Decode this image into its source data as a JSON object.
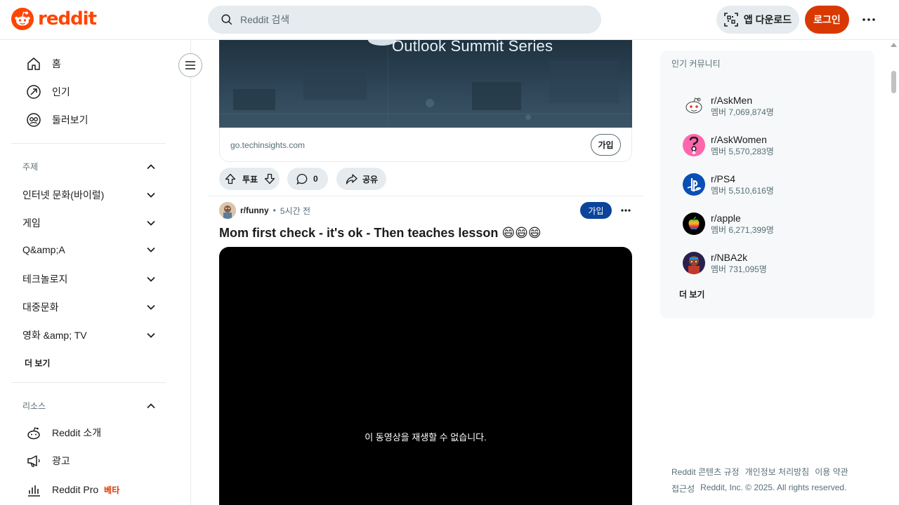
{
  "header": {
    "logo_text": "reddit",
    "search_placeholder": "Reddit 검색",
    "app_download_label": "앱 다운로드",
    "login_label": "로그인"
  },
  "sidebar": {
    "nav": [
      {
        "label": "홈",
        "icon": "home-icon"
      },
      {
        "label": "인기",
        "icon": "popular-icon"
      },
      {
        "label": "둘러보기",
        "icon": "explore-icon"
      }
    ],
    "topics_header": "주제",
    "topics": [
      "인터넷 문화(바이럴)",
      "게임",
      "Q&amp;A",
      "테크놀로지",
      "대중문화",
      "영화 &amp; TV"
    ],
    "more_label": "더 보기",
    "resources_header": "리소스",
    "resources": [
      {
        "label": "Reddit 소개",
        "icon": "reddit-about-icon"
      },
      {
        "label": "광고",
        "icon": "megaphone-icon"
      },
      {
        "label": "Reddit Pro",
        "icon": "bar-chart-icon",
        "badge": "베타"
      }
    ]
  },
  "ad": {
    "banner_text": "Outlook Summit Series",
    "domain": "go.techinsights.com",
    "join_label": "가입"
  },
  "actions": {
    "vote_label": "투표",
    "comment_count": "0",
    "share_label": "공유"
  },
  "post": {
    "subreddit": "r/funny",
    "separator": "•",
    "time": "5시간 전",
    "join_label": "가입",
    "title": "Mom first check - it's ok - Then teaches lesson 😄😄😄",
    "video_message": "이 동영상을 재생할 수 없습니다."
  },
  "rail": {
    "title": "인기 커뮤니티",
    "communities": [
      {
        "name": "r/AskMen",
        "members": "멤버 7,069,874명",
        "icon": "askmen-icon"
      },
      {
        "name": "r/AskWomen",
        "members": "멤버 5,570,283명",
        "icon": "askwomen-icon"
      },
      {
        "name": "r/PS4",
        "members": "멤버 5,510,616명",
        "icon": "playstation-icon"
      },
      {
        "name": "r/apple",
        "members": "멤버 6,271,399명",
        "icon": "apple-icon"
      },
      {
        "name": "r/NBA2k",
        "members": "멤버 731,095명",
        "icon": "nba2k-icon"
      }
    ],
    "more_label": "더 보기"
  },
  "footer": {
    "links_row1": [
      "Reddit 콘텐츠 규정",
      "개인정보 처리방침",
      "이용 약관"
    ],
    "accessibility": "접근성",
    "copyright": "Reddit, Inc. © 2025. All rights reserved."
  },
  "colors": {
    "brand": "#ff4500",
    "login": "#d93900",
    "join_blue": "#0a449b",
    "pill_bg": "#e5ebee"
  }
}
